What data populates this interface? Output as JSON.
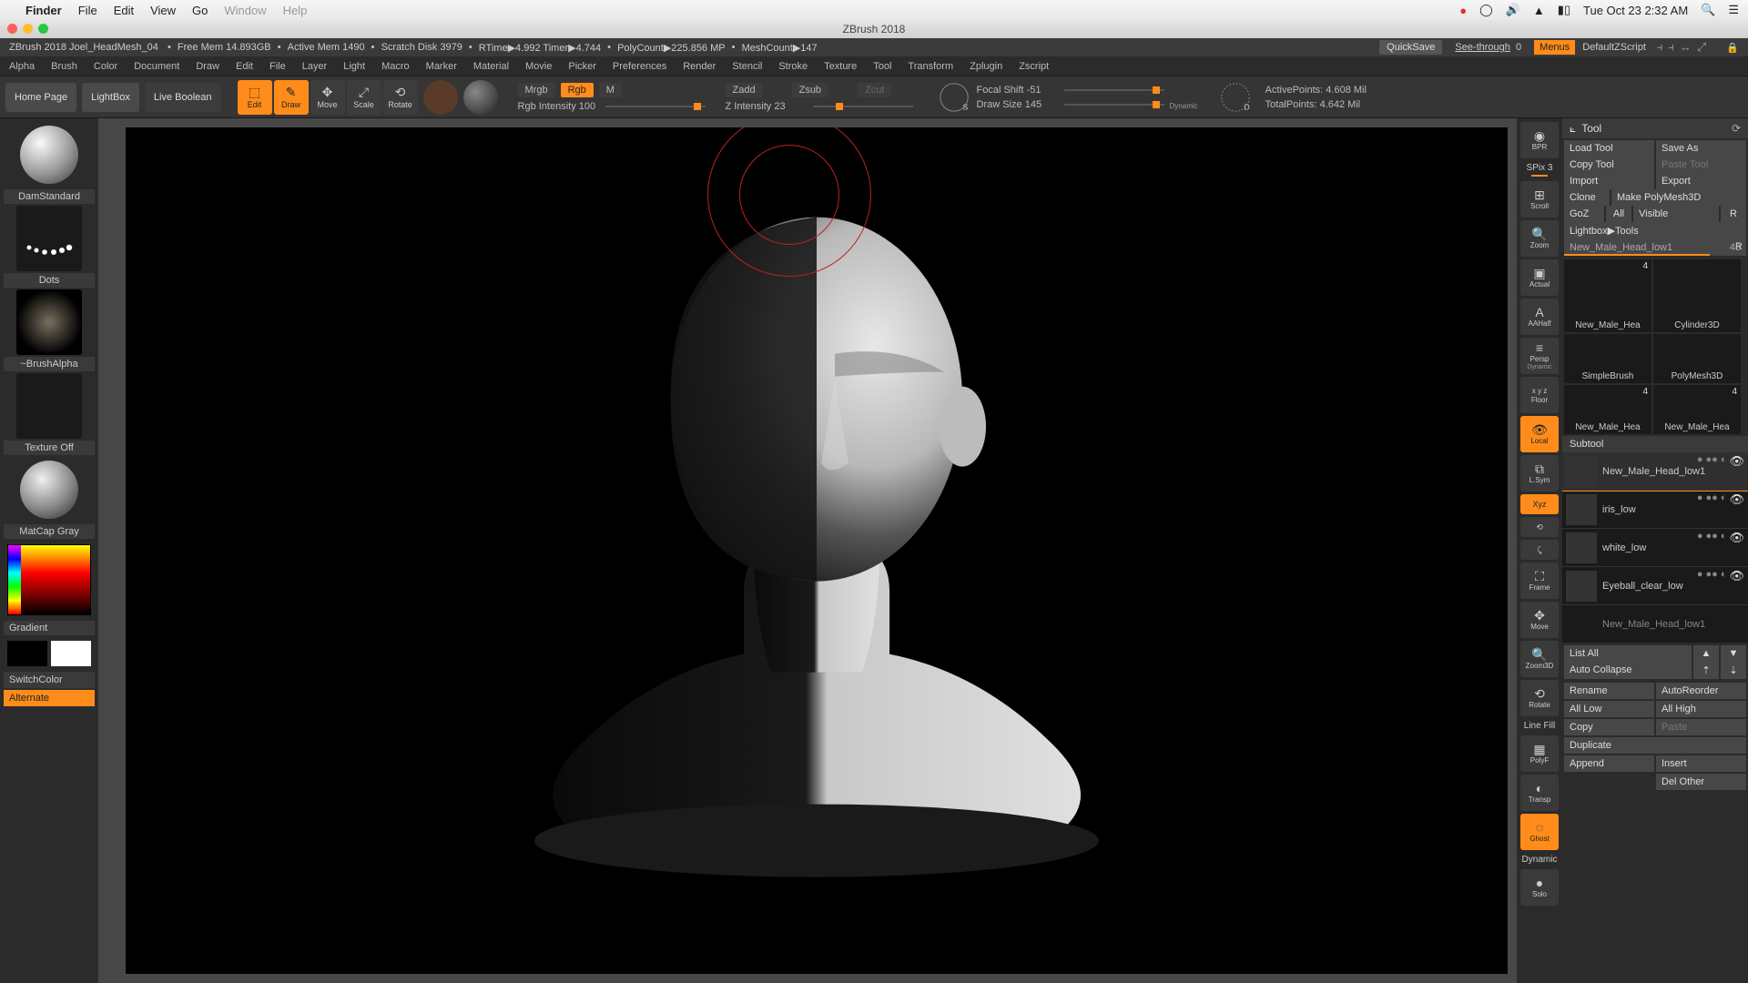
{
  "mac_menu": {
    "app": "Finder",
    "items": [
      "File",
      "Edit",
      "View",
      "Go",
      "Window",
      "Help"
    ],
    "clock": "Tue Oct 23  2:32 AM"
  },
  "titlebar": "ZBrush 2018",
  "statusbar": {
    "project": "ZBrush 2018 Joel_HeadMesh_04",
    "freemem": "Free Mem 14.893GB",
    "activemem": "Active Mem 1490",
    "scratch": "Scratch Disk 3979",
    "rtime": "RTime▶4.992 Timer▶4.744",
    "polycount": "PolyCount▶225.856 MP",
    "meshcount": "MeshCount▶147",
    "quicksave": "QuickSave",
    "seethrough_label": "See-through",
    "seethrough_val": "0",
    "menus": "Menus",
    "defscript": "DefaultZScript"
  },
  "appmenu": [
    "Alpha",
    "Brush",
    "Color",
    "Document",
    "Draw",
    "Edit",
    "File",
    "Layer",
    "Light",
    "Macro",
    "Marker",
    "Material",
    "Movie",
    "Picker",
    "Preferences",
    "Render",
    "Stencil",
    "Stroke",
    "Texture",
    "Tool",
    "Transform",
    "Zplugin",
    "Zscript"
  ],
  "toolbar": {
    "home": "Home Page",
    "lightbox": "LightBox",
    "liveboolean": "Live Boolean",
    "modes": [
      {
        "label": "Edit",
        "active": true
      },
      {
        "label": "Draw",
        "active": true
      },
      {
        "label": "Move",
        "active": false
      },
      {
        "label": "Scale",
        "active": false
      },
      {
        "label": "Rotate",
        "active": false
      }
    ],
    "mrgb": "Mrgb",
    "rgb": "Rgb",
    "m": "M",
    "rgb_intensity_label": "Rgb Intensity",
    "rgb_intensity": "100",
    "zadd": "Zadd",
    "zsub": "Zsub",
    "zcut": "Zcut",
    "z_intensity_label": "Z Intensity",
    "z_intensity": "23",
    "focal_label": "Focal Shift",
    "focal": "-51",
    "draw_label": "Draw Size",
    "draw": "145",
    "dynamic": "Dynamic",
    "active_pts_label": "ActivePoints:",
    "active_pts": "4.608 Mil",
    "total_pts_label": "TotalPoints:",
    "total_pts": "4.642 Mil"
  },
  "left": {
    "brush": "DamStandard",
    "stroke": "Dots",
    "alpha": "~BrushAlpha",
    "texture": "Texture Off",
    "material": "MatCap Gray",
    "gradient": "Gradient",
    "switchcolor": "SwitchColor",
    "alternate": "Alternate"
  },
  "rightstrip": {
    "bpr": "BPR",
    "spix_label": "SPix",
    "spix": "3",
    "items": [
      "Scroll",
      "Zoom",
      "Actual",
      "AAHalf",
      "Persp",
      "Floor",
      "Local",
      "L.Sym",
      "Xyz",
      "Frame",
      "Move",
      "Zoom3D",
      "Rotate",
      "PolyF",
      "Transp",
      "Ghost",
      "Solo"
    ],
    "linefill": "Line Fill",
    "dynamic": "Dynamic",
    "xyzlbl": "x y z"
  },
  "tool": {
    "header": "Tool",
    "load": "Load Tool",
    "saveas": "Save As",
    "copytool": "Copy Tool",
    "pastetool": "Paste Tool",
    "import": "Import",
    "export": "Export",
    "clone": "Clone",
    "makepoly": "Make PolyMesh3D",
    "goz": "GoZ",
    "all": "All",
    "visible": "Visible",
    "r": "R",
    "lightbox": "Lightbox▶Tools",
    "current_label": "New_Male_Head_low1",
    "current_val": "48",
    "tools": [
      {
        "name": "New_Male_Hea",
        "count": "4"
      },
      {
        "name": "Cylinder3D",
        "count": ""
      },
      {
        "name": "SimpleBrush",
        "count": ""
      },
      {
        "name": "PolyMesh3D",
        "count": ""
      },
      {
        "name": "New_Male_Hea",
        "count": "4"
      },
      {
        "name": "New_Male_Hea",
        "count": "4"
      }
    ],
    "subtool_header": "Subtool",
    "subtools": [
      {
        "name": "New_Male_Head_low1",
        "sel": true
      },
      {
        "name": "iris_low",
        "sel": false
      },
      {
        "name": "white_low",
        "sel": false
      },
      {
        "name": "Eyeball_clear_low",
        "sel": false
      },
      {
        "name": "New_Male_Head_low1",
        "sel": false
      }
    ],
    "listall": "List All",
    "autocollapse": "Auto Collapse",
    "rename": "Rename",
    "autoreorder": "AutoReorder",
    "alllow": "All Low",
    "allhigh": "All High",
    "copy": "Copy",
    "paste": "Paste",
    "duplicate": "Duplicate",
    "append": "Append",
    "insert": "Insert",
    "delother": "Del Other"
  }
}
